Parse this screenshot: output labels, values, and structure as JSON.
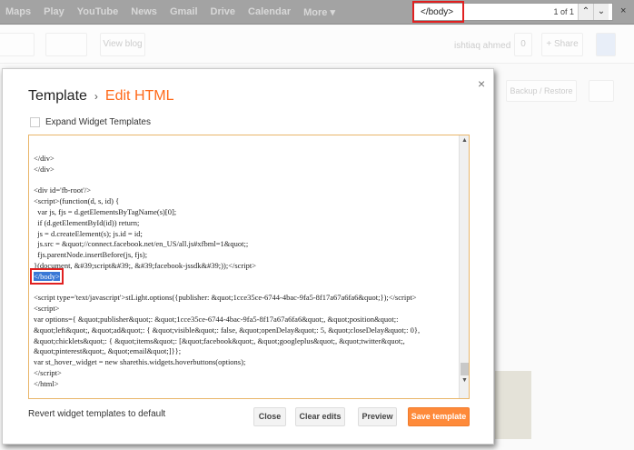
{
  "topbar": {
    "nav": [
      "Maps",
      "Play",
      "YouTube",
      "News",
      "Gmail",
      "Drive",
      "Calendar",
      "More ▾"
    ]
  },
  "find": {
    "query": "</body>",
    "count": "1 of 1",
    "prev": "⌃",
    "next": "⌄",
    "close": "×"
  },
  "header": {
    "view_blog": "View blog",
    "user": "ishtiaq ahmed",
    "count": "0",
    "share": "+ Share",
    "backup": "Backup / Restore"
  },
  "dialog": {
    "crumb": "Template",
    "sep": "›",
    "current": "Edit HTML",
    "close": "×",
    "expand_label": "Expand Widget Templates",
    "code_before": "</div>\n</div>\n\n<div id='fb-root'/>\n<script>(function(d, s, id) {\n  var js, fjs = d.getElementsByTagName(s)[0];\n  if (d.getElementById(id)) return;\n  js = d.createElement(s); js.id = id;\n  js.src = &quot;//connect.facebook.net/en_US/all.js#xfbml=1&quot;;\n  fjs.parentNode.insertBefore(js, fjs);\n}(document, &#39;script&#39;, &#39;facebook-jssdk&#39;));</script>\n",
    "code_match": "</body>",
    "code_after": "\n\n<script type='text/javascript'>stLight.options({publisher: &quot;1cce35ce-6744-4bac-9fa5-8f17a67a6fa6&quot;});</script>\n<script>\nvar options={ &quot;publisher&quot;: &quot;1cce35ce-6744-4bac-9fa5-8f17a67a6fa6&quot;, &quot;position&quot;:\n&quot;left&quot;, &quot;ad&quot;: { &quot;visible&quot;: false, &quot;openDelay&quot;: 5, &quot;closeDelay&quot;: 0},\n&quot;chicklets&quot;: { &quot;items&quot;: [&quot;facebook&quot;, &quot;googleplus&quot;, &quot;twitter&quot;,\n&quot;pinterest&quot;, &quot;email&quot;]}};\nvar st_hover_widget = new sharethis.widgets.hoverbuttons(options);\n</script>\n</html>",
    "revert": "Revert widget templates to default",
    "buttons": {
      "close": "Close",
      "clear": "Clear edits",
      "preview": "Preview",
      "save": "Save template"
    }
  }
}
